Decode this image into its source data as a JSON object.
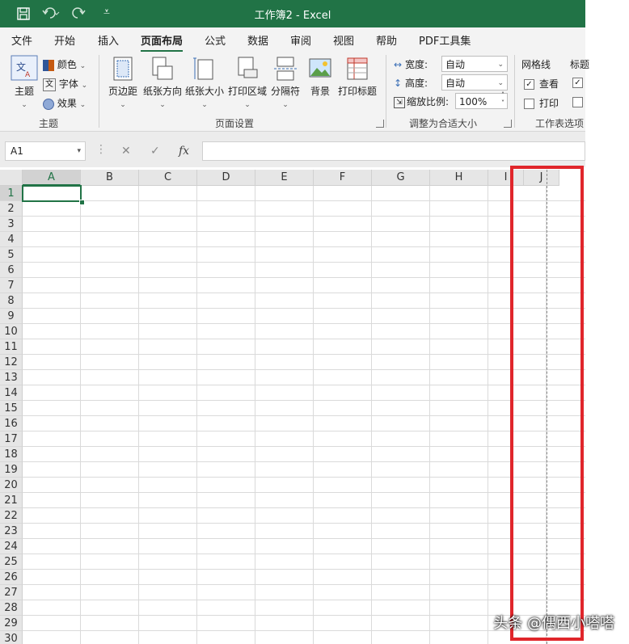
{
  "titlebar": {
    "title": "工作簿2  -  Excel",
    "save_icon": "save-icon",
    "undo_icon": "undo-icon",
    "redo_icon": "redo-icon",
    "customize_icon": "customize-icon"
  },
  "tabs": [
    "文件",
    "开始",
    "插入",
    "页面布局",
    "公式",
    "数据",
    "审阅",
    "视图",
    "帮助",
    "PDF工具集"
  ],
  "active_tab": "页面布局",
  "ribbon": {
    "themes": {
      "theme_label": "主题",
      "colors_label": "颜色",
      "fonts_label": "字体",
      "effects_label": "效果",
      "group_label": "主题"
    },
    "page_setup": {
      "buttons": [
        "页边距",
        "纸张方向",
        "纸张大小",
        "打印区域",
        "分隔符",
        "背景",
        "打印标题"
      ],
      "group_label": "页面设置"
    },
    "scale_to_fit": {
      "width_label": "宽度:",
      "width_value": "自动",
      "height_label": "高度:",
      "height_value": "自动",
      "scale_label": "缩放比例:",
      "scale_value": "100%",
      "group_label": "调整为合适大小"
    },
    "sheet_options": {
      "gridlines_label": "网格线",
      "view_label": "查看",
      "print_label": "打印",
      "headings_label": "标题",
      "group_label": "工作表选项"
    }
  },
  "formula_bar": {
    "name_box": "A1",
    "fx_label": "fx",
    "cancel_symbol": "✕",
    "enter_symbol": "✓",
    "value": ""
  },
  "sheet": {
    "columns": [
      "A",
      "B",
      "C",
      "D",
      "E",
      "F",
      "G",
      "H",
      "I",
      "J"
    ],
    "rows": [
      "1",
      "2",
      "3",
      "4",
      "5",
      "6",
      "7",
      "8",
      "9",
      "10",
      "11",
      "12",
      "13",
      "14",
      "15",
      "16",
      "17",
      "18",
      "19",
      "20",
      "21",
      "22",
      "23",
      "24",
      "25",
      "26",
      "27",
      "28",
      "29",
      "30"
    ],
    "active_cell": "A1"
  },
  "colors": {
    "excel_green": "#217346",
    "highlight_red": "#e0262b"
  },
  "watermark": "头条 @偶西小嗒嗒"
}
